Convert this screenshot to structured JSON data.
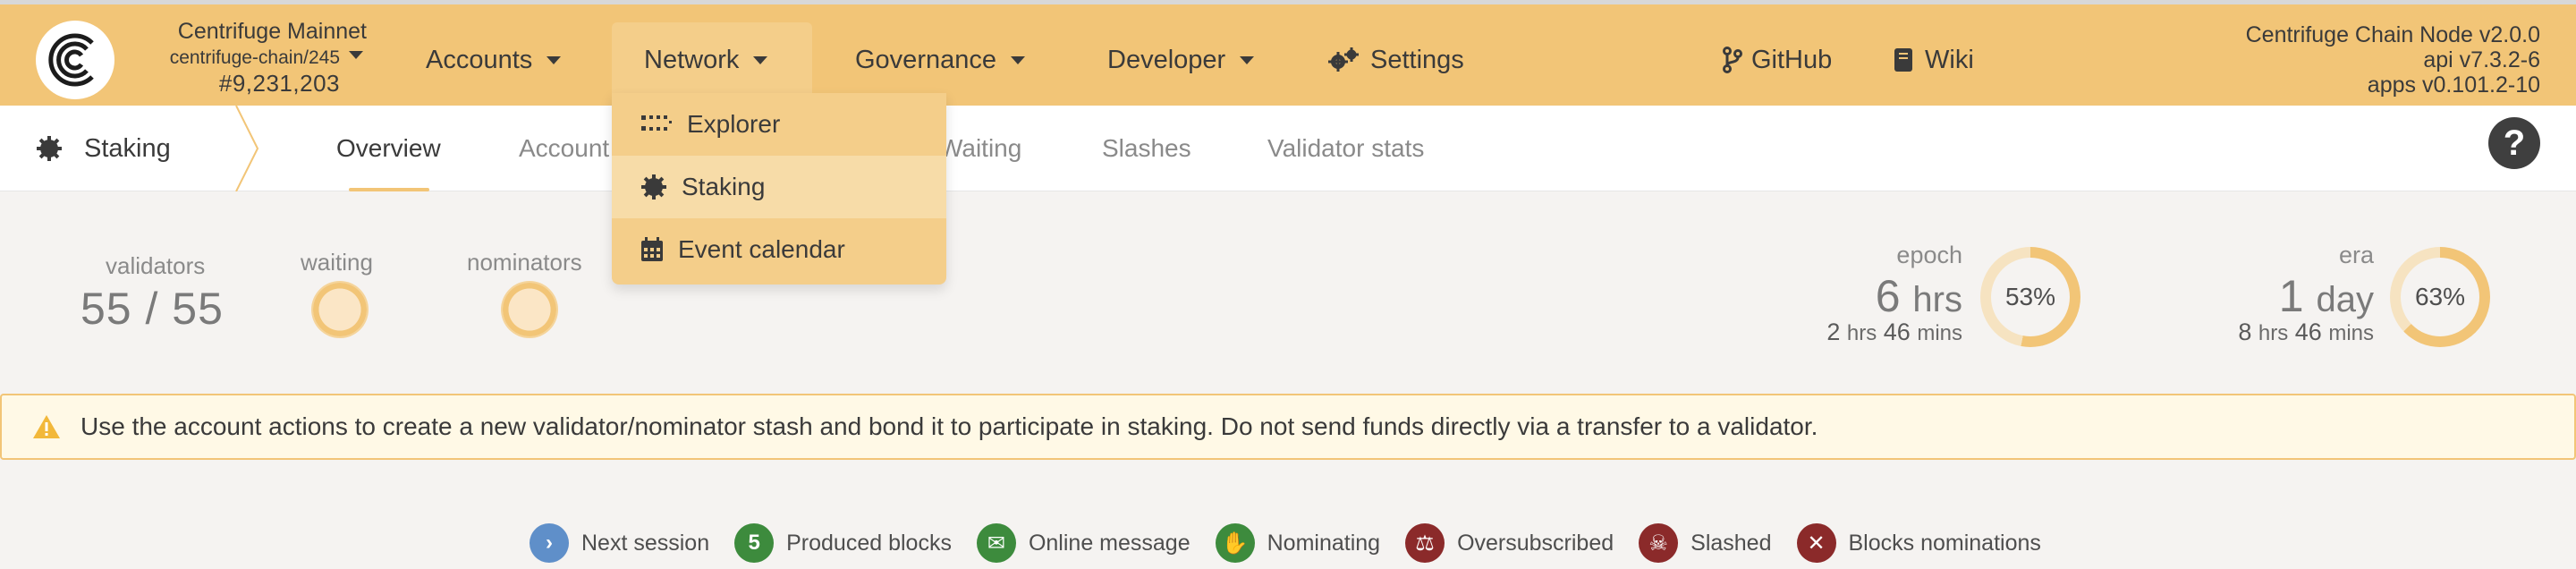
{
  "chain": {
    "name": "Centrifuge Mainnet",
    "spec": "centrifuge-chain/245",
    "block": "#9,231,203"
  },
  "nav": {
    "accounts": "Accounts",
    "network": "Network",
    "governance": "Governance",
    "developer": "Developer",
    "settings": "Settings",
    "github": "GitHub",
    "wiki": "Wiki"
  },
  "node": {
    "line1": "Centrifuge Chain Node v2.0.0",
    "line2": "api v7.3.2-6",
    "line3": "apps v0.101.2-10"
  },
  "dropdown": {
    "items": [
      {
        "label": "Explorer",
        "icon": "grid-dots-icon"
      },
      {
        "label": "Staking",
        "icon": "staking-cog-icon"
      },
      {
        "label": "Event calendar",
        "icon": "calendar-icon"
      }
    ]
  },
  "subnav": {
    "section": "Staking",
    "tabs": [
      "Overview",
      "Account",
      "Waiting",
      "Slashes",
      "Validator stats"
    ]
  },
  "summary": {
    "validators_label": "validators",
    "validators_value": "55 / 55",
    "waiting_label": "waiting",
    "nominators_label": "nominators",
    "epoch": {
      "label": "epoch",
      "big_num": "6",
      "big_unit": "hrs",
      "sub_h": "2",
      "sub_h_unit": "hrs",
      "sub_m": "46",
      "sub_m_unit": "mins",
      "percent": "53%",
      "fraction": 0.53
    },
    "era": {
      "label": "era",
      "big_num": "1",
      "big_unit": "day",
      "sub_h": "8",
      "sub_h_unit": "hrs",
      "sub_m": "46",
      "sub_m_unit": "mins",
      "percent": "63%",
      "fraction": 0.63
    }
  },
  "warning": "Use the account actions to create a new validator/nominator stash and bond it to participate in staking. Do not send funds directly via a transfer to a validator.",
  "legend": [
    {
      "label": "Next session",
      "color": "#5f8fc9",
      "glyph": "›",
      "icon": "chevron-right-icon"
    },
    {
      "label": "Produced blocks",
      "color": "#3d8b3d",
      "glyph": "5",
      "icon": "count-badge"
    },
    {
      "label": "Online message",
      "color": "#3d8b3d",
      "glyph": "✉",
      "icon": "envelope-icon"
    },
    {
      "label": "Nominating",
      "color": "#3d8b3d",
      "glyph": "✋",
      "icon": "hand-icon"
    },
    {
      "label": "Oversubscribed",
      "color": "#8b2a2a",
      "glyph": "⚖",
      "icon": "scale-icon"
    },
    {
      "label": "Slashed",
      "color": "#8b2a2a",
      "glyph": "☠",
      "icon": "skull-icon"
    },
    {
      "label": "Blocks nominations",
      "color": "#8b2a2a",
      "glyph": "✕",
      "icon": "blocked-user-icon"
    }
  ],
  "colors": {
    "accent": "#f2c577",
    "ring_track": "#f6e3c1"
  }
}
